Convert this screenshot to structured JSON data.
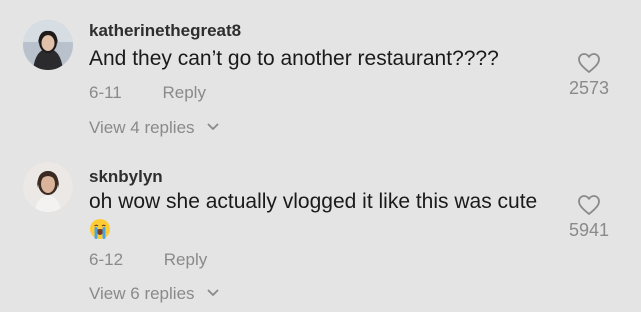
{
  "comments": [
    {
      "username": "katherinethegreat8",
      "text": "And they can’t go to another restaurant????",
      "date": "6-11",
      "reply_label": "Reply",
      "view_replies": "View 4 replies",
      "likes": "2573",
      "emoji": ""
    },
    {
      "username": "sknbylyn",
      "text": "oh wow she actually vlogged it like this was cute",
      "date": "6-12",
      "reply_label": "Reply",
      "view_replies": "View 6 replies",
      "likes": "5941",
      "emoji": "loudly-crying-face-emoji"
    }
  ],
  "colors": {
    "background": "#e4e4e4",
    "username": "#2e2e2e",
    "text": "#1a1a1a",
    "muted": "#8a8a8a"
  }
}
